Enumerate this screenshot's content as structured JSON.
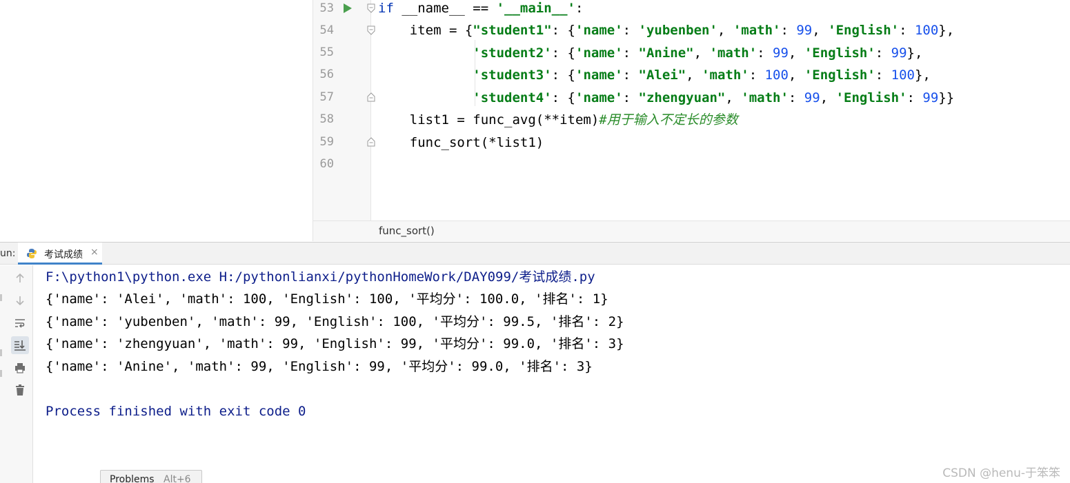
{
  "editor": {
    "line_numbers": [
      "53",
      "54",
      "55",
      "56",
      "57",
      "58",
      "59",
      "60"
    ],
    "lines": {
      "l53": {
        "kw": "if",
        "t1": " __name__ == ",
        "s1": "'__main__'",
        "t2": ":"
      },
      "l54": {
        "t1": "    item = {",
        "s1": "\"student1\"",
        "t2": ": {",
        "s2": "'name'",
        "t3": ": ",
        "s3": "'yubenben'",
        "t4": ", ",
        "s4": "'math'",
        "t5": ": ",
        "n1": "99",
        "t6": ", ",
        "s5": "'English'",
        "t7": ": ",
        "n2": "100",
        "t8": "},"
      },
      "l55": {
        "t1": "            ",
        "s1": "'student2'",
        "t2": ": {",
        "s2": "'name'",
        "t3": ": ",
        "s3": "\"Anine\"",
        "t4": ", ",
        "s4": "'math'",
        "t5": ": ",
        "n1": "99",
        "t6": ", ",
        "s5": "'English'",
        "t7": ": ",
        "n2": "99",
        "t8": "},"
      },
      "l56": {
        "t1": "            ",
        "s1": "'student3'",
        "t2": ": {",
        "s2": "'name'",
        "t3": ": ",
        "s3": "\"Alei\"",
        "t4": ", ",
        "s4": "'math'",
        "t5": ": ",
        "n1": "100",
        "t6": ", ",
        "s5": "'English'",
        "t7": ": ",
        "n2": "100",
        "t8": "},"
      },
      "l57": {
        "t1": "            ",
        "s1": "'student4'",
        "t2": ": {",
        "s2": "'name'",
        "t3": ": ",
        "s3": "\"zhengyuan\"",
        "t4": ", ",
        "s4": "'math'",
        "t5": ": ",
        "n1": "99",
        "t6": ", ",
        "s5": "'English'",
        "t7": ": ",
        "n2": "99",
        "t8": "}}"
      },
      "l58": {
        "t1": "    list1 = func_avg(**item)",
        "c1": "#用于输入不定长的参数"
      },
      "l59": {
        "t1": "    func_sort(*list1)"
      }
    },
    "breadcrumb": "func_sort()"
  },
  "run_panel": {
    "label": "un:",
    "tab_title": "考试成绩",
    "tab_close": "×",
    "output": [
      "F:\\python1\\python.exe H:/pythonlianxi/pythonHomeWork/DAY099/考试成绩.py",
      "{'name': 'Alei', 'math': 100, 'English': 100, '平均分': 100.0, '排名': 1}",
      "{'name': 'yubenben', 'math': 99, 'English': 100, '平均分': 99.5, '排名': 2}",
      "{'name': 'zhengyuan', 'math': 99, 'English': 99, '平均分': 99.0, '排名': 3}",
      "{'name': 'Anine', 'math': 99, 'English': 99, '平均分': 99.0, '排名': 3}",
      "Process finished with exit code 0"
    ],
    "tools": [
      "arrow-up-icon",
      "arrow-down-icon",
      "soft-wrap-icon",
      "scroll-to-end-icon",
      "print-icon",
      "trash-icon"
    ]
  },
  "bottom_tab": {
    "title": "Problems",
    "shortcut": "Alt+6"
  },
  "watermark": "CSDN @henu-于笨笨",
  "colors": {
    "keyword": "#0033b3",
    "string": "#067d17",
    "number": "#1750eb",
    "comment": "#2a8c2a",
    "console_path": "#0d1e8a",
    "run_icon": "#4a9f4e",
    "tab_accent": "#4083c9"
  }
}
